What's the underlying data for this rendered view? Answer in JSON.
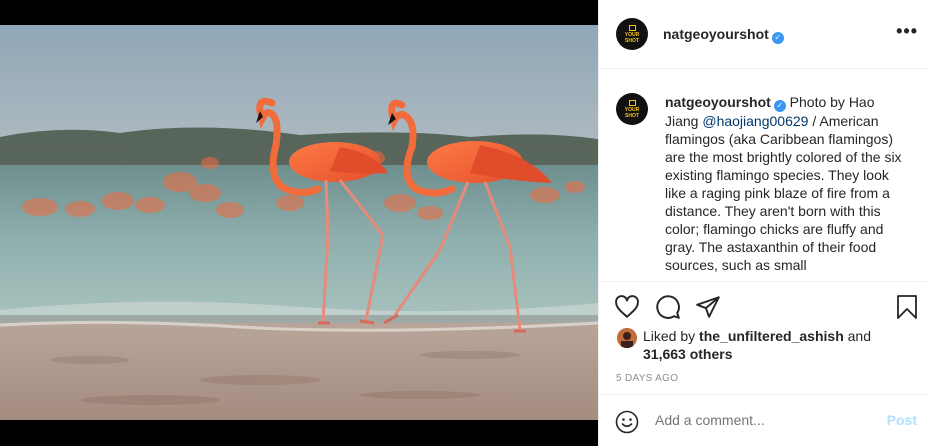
{
  "post": {
    "username": "natgeoyourshot",
    "verified_symbol": "✓",
    "avatar_text": "YOUR SHOT",
    "more_label": "•••",
    "caption": {
      "username": "natgeoyourshot",
      "text_before": "Photo by Hao Jiang ",
      "mention": "@haojiang00629",
      "text_after": " / American flamingos (aka Caribbean flamingos) are the most brightly colored of the six existing flamingo species. They look like a raging pink blaze of fire from a distance. They aren't born with this color; flamingo chicks are fluffy and gray. The astaxanthin of their food sources, such as small"
    },
    "icons": {
      "like": "heart-icon",
      "comment": "comment-icon",
      "share": "paper-plane-icon",
      "save": "bookmark-icon",
      "emoji": "smiley-icon"
    },
    "likes": {
      "prefix": "Liked by ",
      "liker": "the_unfiltered_ashish",
      "middle": " and",
      "count": "31,663 others"
    },
    "timestamp": "5 DAYS AGO",
    "comment_placeholder": "Add a comment...",
    "post_label": "Post"
  },
  "colors": {
    "verified": "#3897f0",
    "link": "#00376b",
    "post_disabled": "#b2dffc",
    "meta": "#8e8e8e"
  }
}
